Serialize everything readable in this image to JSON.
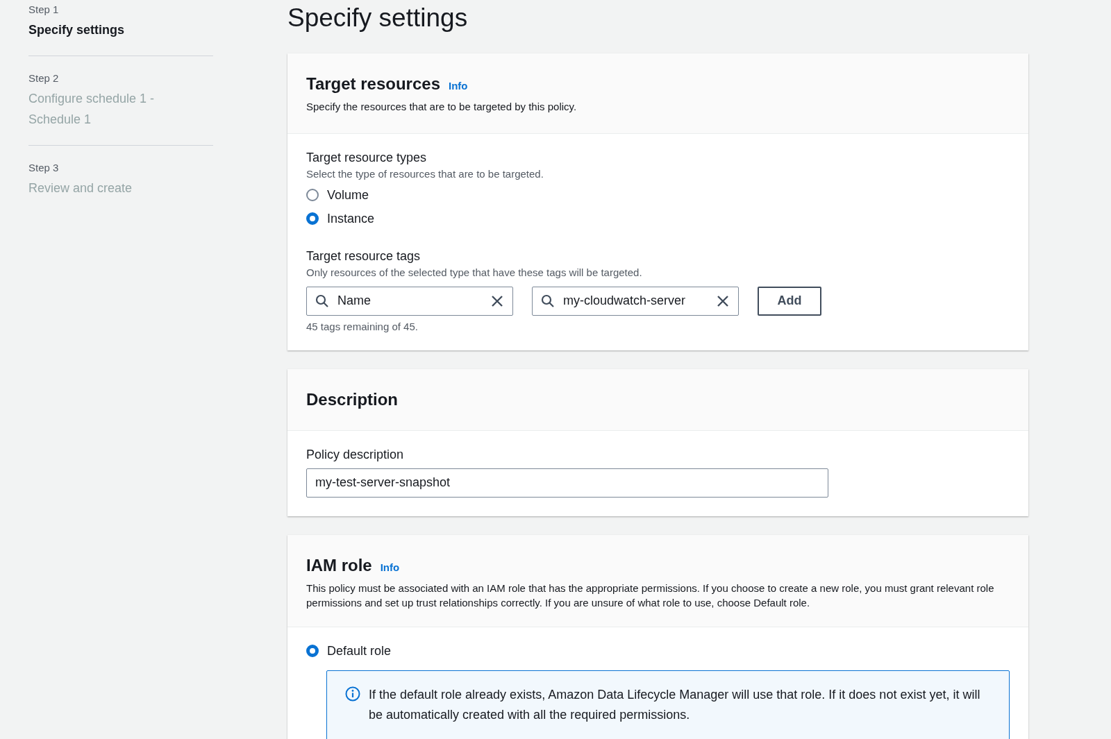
{
  "steps": [
    {
      "label": "Step 1",
      "title": "Specify settings",
      "selected": true
    },
    {
      "label": "Step 2",
      "title": "Configure schedule 1 - Schedule 1",
      "selected": false
    },
    {
      "label": "Step 3",
      "title": "Review and create",
      "selected": false
    }
  ],
  "page_title": "Specify settings",
  "target_resources": {
    "title": "Target resources",
    "info": "Info",
    "description": "Specify the resources that are to be targeted by this policy.",
    "types": {
      "label": "Target resource types",
      "hint": "Select the type of resources that are to be targeted.",
      "options": [
        {
          "label": "Volume",
          "selected": false
        },
        {
          "label": "Instance",
          "selected": true
        }
      ]
    },
    "tags": {
      "label": "Target resource tags",
      "hint": "Only resources of the selected type that have these tags will be targeted.",
      "key": "Name",
      "value": "my-cloudwatch-server",
      "add_button": "Add",
      "remaining": "45 tags remaining of 45."
    }
  },
  "description": {
    "title": "Description",
    "field_label": "Policy description",
    "value": "my-test-server-snapshot"
  },
  "iam_role": {
    "title": "IAM role",
    "info": "Info",
    "description": "This policy must be associated with an IAM role that has the appropriate permissions. If you choose to create a new role, you must grant relevant role permissions and set up trust relationships correctly. If you are unsure of what role to use, choose Default role.",
    "options": [
      {
        "label": "Default role",
        "selected": true
      }
    ],
    "alert": "If the default role already exists, Amazon Data Lifecycle Manager will use that role. If it does not exist yet, it will be automatically created with all the required permissions."
  }
}
